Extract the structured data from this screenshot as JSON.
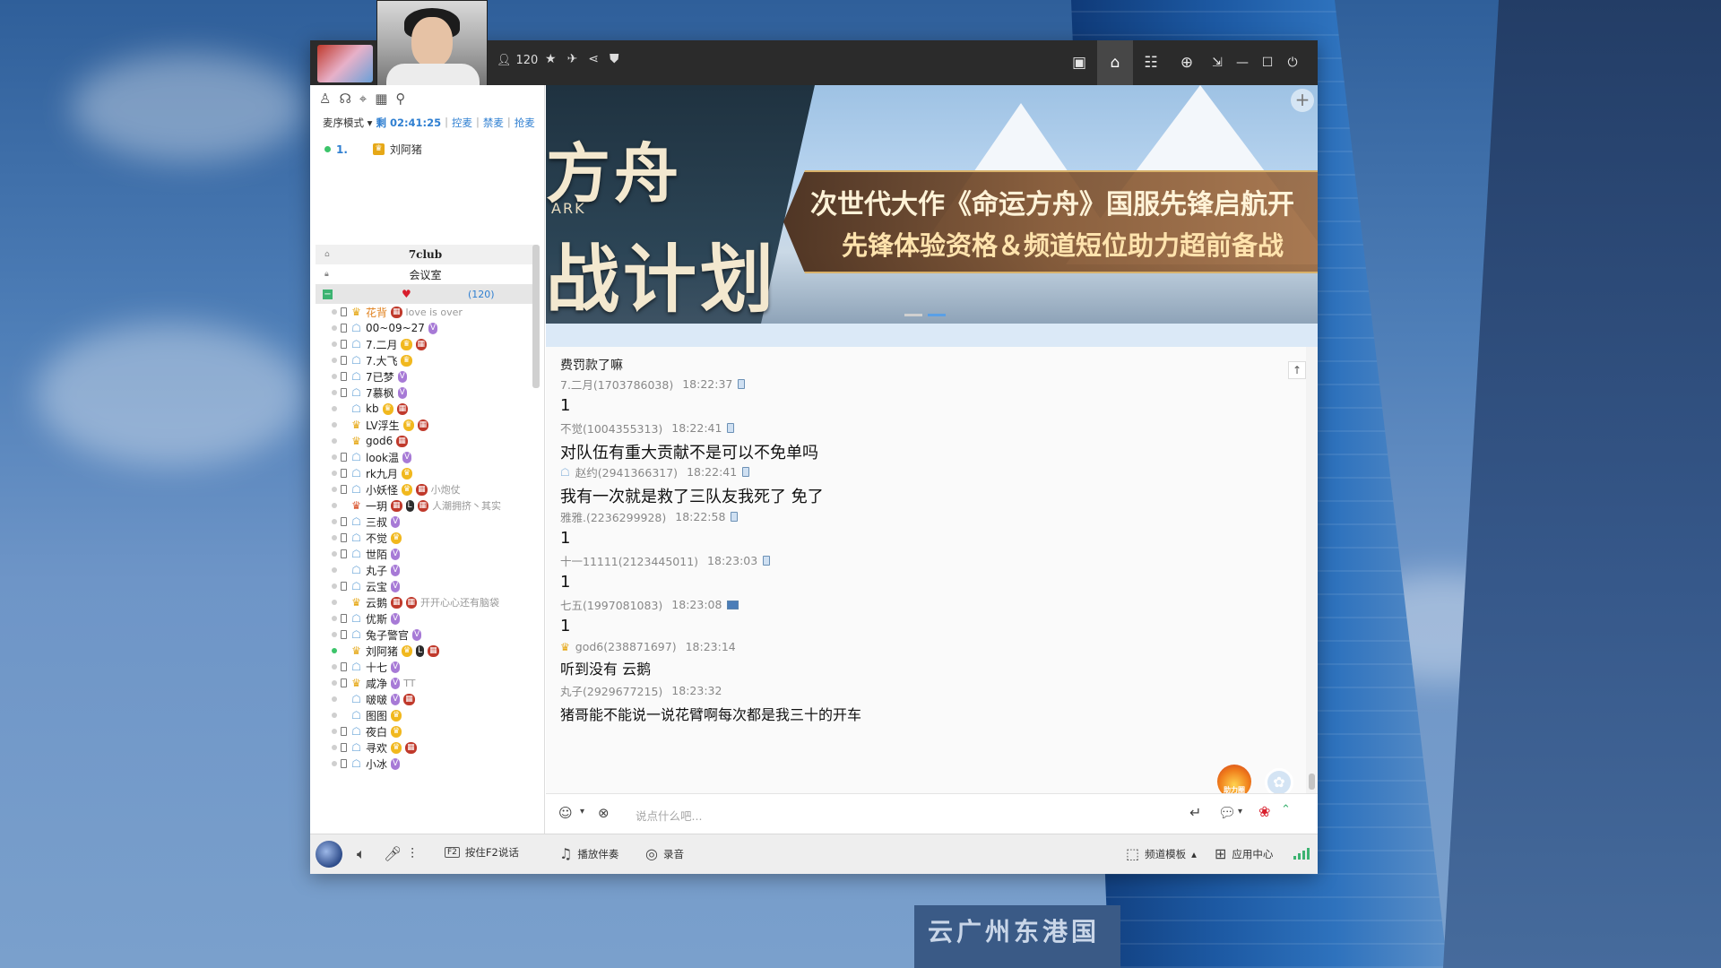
{
  "titlebar": {
    "online_count": "120"
  },
  "left_panel": {
    "mic_mode": "麦序模式",
    "remaining_label": "剩",
    "timer": "02:41:25",
    "ctrl_mic": "控麦",
    "ban_mic": "禁麦",
    "grab_mic": "抢麦",
    "queue": [
      {
        "num": "1.",
        "name": "刘阿猪"
      }
    ],
    "tree": {
      "club": "7club",
      "meeting_room": "会议室",
      "room_count": "(120)"
    },
    "members": [
      {
        "name": "花背",
        "sig": "love is over",
        "online": false,
        "phone": true,
        "role": "gold",
        "badges": [
          "s"
        ],
        "orange": true
      },
      {
        "name": "00~09~27",
        "sig": "",
        "online": false,
        "phone": true,
        "role": "blue",
        "badges": [
          "v"
        ],
        "orange": false
      },
      {
        "name": "7.二月",
        "sig": "",
        "online": false,
        "phone": true,
        "role": "blue",
        "badges": [
          "c",
          "s"
        ],
        "orange": false
      },
      {
        "name": "7.大飞",
        "sig": "",
        "online": false,
        "phone": true,
        "role": "blue",
        "badges": [
          "c"
        ],
        "orange": false
      },
      {
        "name": "7已梦",
        "sig": "",
        "online": false,
        "phone": true,
        "role": "blue",
        "badges": [
          "v"
        ],
        "orange": false
      },
      {
        "name": "7慕枫",
        "sig": "",
        "online": false,
        "phone": true,
        "role": "blue",
        "badges": [
          "v"
        ],
        "orange": false
      },
      {
        "name": "kb",
        "sig": "",
        "online": false,
        "phone": false,
        "role": "blue",
        "badges": [
          "c",
          "s"
        ],
        "orange": false
      },
      {
        "name": "LV浮生",
        "sig": "",
        "online": false,
        "phone": false,
        "role": "gold",
        "badges": [
          "c",
          "s"
        ],
        "orange": false
      },
      {
        "name": "god6",
        "sig": "",
        "online": false,
        "phone": false,
        "role": "gold",
        "badges": [
          "s"
        ],
        "orange": false
      },
      {
        "name": "look温",
        "sig": "",
        "online": false,
        "phone": true,
        "role": "blue",
        "badges": [
          "v"
        ],
        "orange": false
      },
      {
        "name": "rk九月",
        "sig": "",
        "online": false,
        "phone": true,
        "role": "blue",
        "badges": [
          "c"
        ],
        "orange": false
      },
      {
        "name": "小妖怪",
        "sig": "小炮仗",
        "online": false,
        "phone": true,
        "role": "blue",
        "badges": [
          "c",
          "s"
        ],
        "orange": false
      },
      {
        "name": "一玥",
        "sig": "人潮拥挤丶其实",
        "online": false,
        "phone": false,
        "role": "red",
        "badges": [
          "s",
          "l",
          "s"
        ],
        "orange": false
      },
      {
        "name": "三叔",
        "sig": "",
        "online": false,
        "phone": true,
        "role": "blue",
        "badges": [
          "v"
        ],
        "orange": false
      },
      {
        "name": "不觉",
        "sig": "",
        "online": false,
        "phone": true,
        "role": "blue",
        "badges": [
          "c"
        ],
        "orange": false
      },
      {
        "name": "世陌",
        "sig": "",
        "online": false,
        "phone": true,
        "role": "blue",
        "badges": [
          "v"
        ],
        "orange": false
      },
      {
        "name": "丸子",
        "sig": "",
        "online": false,
        "phone": false,
        "role": "blue",
        "badges": [
          "v"
        ],
        "orange": false
      },
      {
        "name": "云宝",
        "sig": "",
        "online": false,
        "phone": true,
        "role": "blue",
        "badges": [
          "v"
        ],
        "orange": false
      },
      {
        "name": "云鹅",
        "sig": "开开心心还有脑袋",
        "online": false,
        "phone": false,
        "role": "gold",
        "badges": [
          "s",
          "s"
        ],
        "orange": false
      },
      {
        "name": "优斯",
        "sig": "",
        "online": false,
        "phone": true,
        "role": "blue",
        "badges": [
          "v"
        ],
        "orange": false
      },
      {
        "name": "兔子警官",
        "sig": "",
        "online": false,
        "phone": true,
        "role": "blue",
        "badges": [
          "v"
        ],
        "orange": false
      },
      {
        "name": "刘阿猪",
        "sig": "",
        "online": true,
        "phone": false,
        "role": "gold",
        "badges": [
          "c",
          "l",
          "s"
        ],
        "orange": false
      },
      {
        "name": "十七",
        "sig": "",
        "online": false,
        "phone": true,
        "role": "blue",
        "badges": [
          "v"
        ],
        "orange": false
      },
      {
        "name": "咸净",
        "sig": "TT",
        "online": false,
        "phone": true,
        "role": "gold",
        "badges": [
          "v"
        ],
        "orange": false
      },
      {
        "name": "啵啵",
        "sig": "",
        "online": false,
        "phone": false,
        "role": "blue",
        "badges": [
          "v",
          "s"
        ],
        "orange": false
      },
      {
        "name": "图图",
        "sig": "",
        "online": false,
        "phone": false,
        "role": "blue",
        "badges": [
          "c"
        ],
        "orange": false
      },
      {
        "name": "夜白",
        "sig": "",
        "online": false,
        "phone": true,
        "role": "blue",
        "badges": [
          "c"
        ],
        "orange": false
      },
      {
        "name": "寻欢",
        "sig": "",
        "online": false,
        "phone": true,
        "role": "blue",
        "badges": [
          "c",
          "s"
        ],
        "orange": false
      },
      {
        "name": "小冰",
        "sig": "",
        "online": false,
        "phone": true,
        "role": "blue",
        "badges": [
          "v"
        ],
        "orange": false
      }
    ]
  },
  "banner": {
    "title_top": "方舟",
    "ark": "ARK",
    "title_bottom": "战计划",
    "line1": "次世代大作《命运方舟》国服先锋启航开",
    "line2": "先锋体验资格＆频道短位助力超前备战"
  },
  "chat": {
    "notice": "费罚款了嘛",
    "messages": [
      {
        "sender": "7.二月(1703786038)",
        "time": "18:22:37",
        "device": "phone",
        "role": "",
        "body": "1"
      },
      {
        "sender": "不觉(1004355313)",
        "time": "18:22:41",
        "device": "phone",
        "role": "",
        "body": "对队伍有重大贡献不是可以不免单吗"
      },
      {
        "sender": "赵约(2941366317)",
        "time": "18:22:41",
        "device": "phone",
        "role": "blue",
        "body": "我有一次就是救了三队友我死了 免了"
      },
      {
        "sender": "雅雅.(2236299928)",
        "time": "18:22:58",
        "device": "phone",
        "role": "",
        "body": "1"
      },
      {
        "sender": "十一11111(2123445011)",
        "time": "18:23:03",
        "device": "phone",
        "role": "",
        "body": "1"
      },
      {
        "sender": "七五(1997081083)",
        "time": "18:23:08",
        "device": "pc",
        "role": "",
        "body": "1"
      },
      {
        "sender": "god6(238871697)",
        "time": "18:23:14",
        "device": "",
        "role": "gold",
        "body": "听到没有 云鹅"
      },
      {
        "sender": "丸子(2929677215)",
        "time": "18:23:32",
        "device": "",
        "role": "",
        "body": "猪哥能不能说一说花臂啊每次都是我三十的开车"
      }
    ],
    "fire_label": "助力圈"
  },
  "input": {
    "placeholder": "说点什么吧..."
  },
  "bottom_bar": {
    "push_to_talk": "按住F2说话",
    "key_f2": "F2",
    "play_music": "播放伴奏",
    "record": "录音",
    "channel_template": "频道模板",
    "app_center": "应用中心"
  },
  "desktop": {
    "sign": "云广州东港国"
  }
}
